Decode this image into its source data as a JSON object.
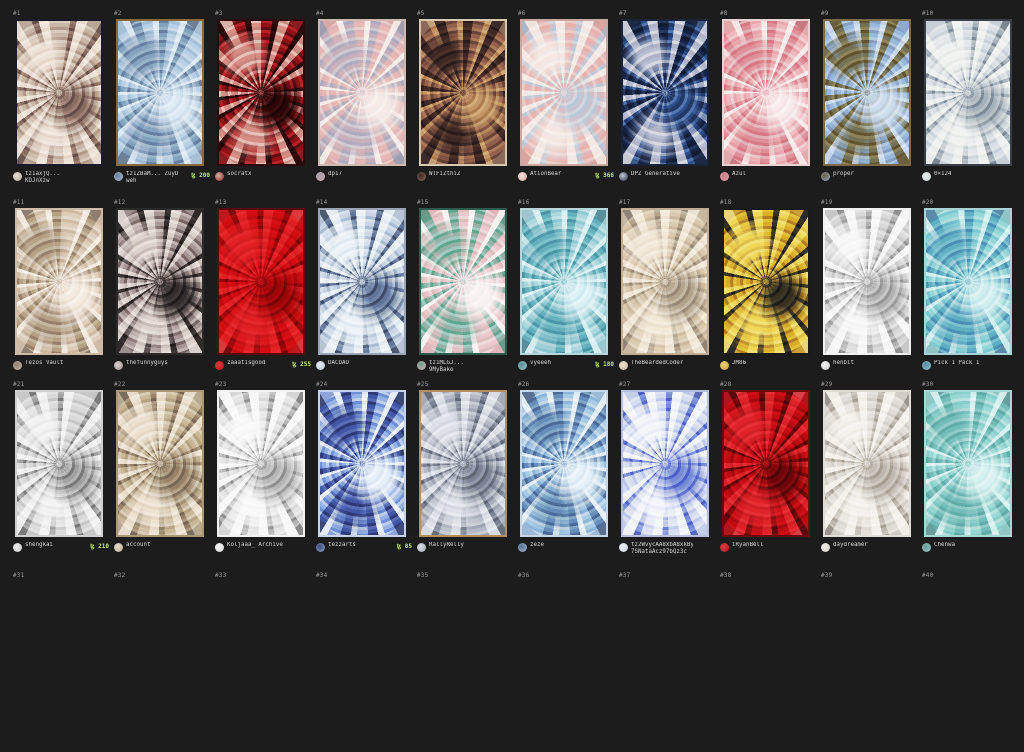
{
  "items": [
    {
      "num": "#1",
      "owner": "tz1axjQ... KDJnXzw",
      "price": "",
      "colors": [
        "#b9a79a",
        "#6d5a55",
        "#e8ddd2"
      ],
      "frame": "#1a1a2a"
    },
    {
      "num": "#2",
      "owner": "tz1ZBaM... ZuyD\nweh",
      "price": "ꜩ 200",
      "colors": [
        "#a9bfd6",
        "#d6e2ee",
        "#6e7f96"
      ],
      "frame": "#8a6a3a"
    },
    {
      "num": "#3",
      "owner": "socratx",
      "price": "",
      "colors": [
        "#8a1c22",
        "#2a0a0c",
        "#d8b0a8"
      ],
      "frame": "#2a0c0e"
    },
    {
      "num": "#4",
      "owner": "dp17",
      "price": "",
      "colors": [
        "#d9a9a6",
        "#f1e6e2",
        "#9f9eae"
      ],
      "frame": "#cdb9b2"
    },
    {
      "num": "#5",
      "owner": "WTFiZthiZ",
      "price": "",
      "colors": [
        "#8c6a5a",
        "#c2a07a",
        "#3a2a2a"
      ],
      "frame": "#d8c8b0"
    },
    {
      "num": "#6",
      "owner": "AtionBear",
      "price": "ꜩ 366",
      "colors": [
        "#d9a3a0",
        "#a8b8c8",
        "#efe2dc"
      ],
      "frame": "#c8a8a0"
    },
    {
      "num": "#7",
      "owner": "DPZ Generative",
      "price": "",
      "colors": [
        "#1c2a44",
        "#3e5a86",
        "#c8c8d4"
      ],
      "frame": "#1a2238"
    },
    {
      "num": "#8",
      "owner": "Azul",
      "price": "",
      "colors": [
        "#e2a9ad",
        "#f3e6e6",
        "#c77a82"
      ],
      "frame": "#e9d2d4"
    },
    {
      "num": "#9",
      "owner": "proper",
      "price": "",
      "colors": [
        "#90aacd",
        "#c8d6e6",
        "#6b6040"
      ],
      "frame": "#7b6a44"
    },
    {
      "num": "#10",
      "owner": "0×124",
      "price": "",
      "colors": [
        "#c9cfd6",
        "#7d8690",
        "#e9ece8"
      ],
      "frame": "#3a3e46"
    },
    {
      "num": "#11",
      "owner": "Tezos Vault",
      "price": "",
      "colors": [
        "#cdbba8",
        "#efe6dc",
        "#8f7f70"
      ],
      "frame": "#cdbba8"
    },
    {
      "num": "#12",
      "owner": "thefunnyguys",
      "price": "",
      "colors": [
        "#9a8e8e",
        "#2e2a2a",
        "#d8d0cc"
      ],
      "frame": "#2a2a2a"
    },
    {
      "num": "#13",
      "owner": "zaaatisgood",
      "price": "ꜩ 255",
      "colors": [
        "#c0161c",
        "#7a0a0e",
        "#d83a3e"
      ],
      "frame": "#5a0a0c"
    },
    {
      "num": "#14",
      "owner": "DACDAO",
      "price": "",
      "colors": [
        "#b8c4d6",
        "#4e5a70",
        "#e6ecf2"
      ],
      "frame": "#9aa6b8"
    },
    {
      "num": "#15",
      "owner": "tz1MLGJ... 9MyBako",
      "price": "",
      "colors": [
        "#e0b6bc",
        "#f6eeee",
        "#6a9a8a"
      ],
      "frame": "#2e5a4e"
    },
    {
      "num": "#16",
      "owner": "vyeeeh",
      "price": "ꜩ 180",
      "colors": [
        "#9fc6cf",
        "#d6ecef",
        "#5a8e9a"
      ],
      "frame": "#b6d6dc"
    },
    {
      "num": "#17",
      "owner": "TheBeardedCoder",
      "price": "",
      "colors": [
        "#c9b8a0",
        "#8e8478",
        "#ece2d2"
      ],
      "frame": "#c0ac94"
    },
    {
      "num": "#18",
      "owner": "JM86",
      "price": "",
      "colors": [
        "#c9a03a",
        "#2a2a2a",
        "#e8d27a"
      ],
      "frame": "#1a1a1a"
    },
    {
      "num": "#19",
      "owner": "henbit",
      "price": "",
      "colors": [
        "#c8c8c8",
        "#8e8e8e",
        "#f4f4f4"
      ],
      "frame": "#f0f0f0"
    },
    {
      "num": "#20",
      "owner": "Pick 1 Pack 1",
      "price": "",
      "colors": [
        "#8ec6c8",
        "#cfe9ea",
        "#5a8aa6"
      ],
      "frame": "#a6d4d6"
    },
    {
      "num": "#21",
      "owner": "shengkai",
      "price": "ꜩ 210",
      "colors": [
        "#c8c8c8",
        "#7a7a7a",
        "#ececec"
      ],
      "frame": "#d0d0d0"
    },
    {
      "num": "#22",
      "owner": "account",
      "price": "",
      "colors": [
        "#b8a890",
        "#7a6e60",
        "#e6dccc"
      ],
      "frame": "#a89878"
    },
    {
      "num": "#23",
      "owner": "Koljaaa_ Archive",
      "price": "",
      "colors": [
        "#d6d6d6",
        "#8a8a8a",
        "#f6f6f6"
      ],
      "frame": "#f2f2f2"
    },
    {
      "num": "#24",
      "owner": "tezzarts",
      "price": "ꜩ 85",
      "colors": [
        "#8ea4d8",
        "#e6ecf6",
        "#3e4a78"
      ],
      "frame": "#c8d2ea"
    },
    {
      "num": "#25",
      "owner": "RallyRelly",
      "price": "",
      "colors": [
        "#a6aab4",
        "#6a6e78",
        "#d8dce2"
      ],
      "frame": "#b09060"
    },
    {
      "num": "#26",
      "owner": "zeze",
      "price": "",
      "colors": [
        "#9cbad6",
        "#e2ecf4",
        "#5a7090"
      ],
      "frame": "#c6d8e8"
    },
    {
      "num": "#27",
      "owner": "tz2WvycAA8xbA8xkBy7i\n7SNataAcz97bQz3c",
      "price": "",
      "colors": [
        "#c6cde6",
        "#5a68b8",
        "#eef0f6"
      ],
      "frame": "#b6bedc"
    },
    {
      "num": "#28",
      "owner": "iRyanBell",
      "price": "",
      "colors": [
        "#b0141c",
        "#5a0a0e",
        "#d84046"
      ],
      "frame": "#6a0a0e"
    },
    {
      "num": "#29",
      "owner": "daydreamer",
      "price": "",
      "colors": [
        "#d0ccc6",
        "#9a948c",
        "#f0ece6"
      ],
      "frame": "#e0dcd6"
    },
    {
      "num": "#30",
      "owner": "Chenwa",
      "price": "",
      "colors": [
        "#92c8c4",
        "#d4ecea",
        "#6a9e9c"
      ],
      "frame": "#a8d8d4"
    },
    {
      "num": "#31",
      "owner": "",
      "price": "",
      "colors": [
        "#333",
        "#333",
        "#333"
      ],
      "frame": "#1c1c1c"
    },
    {
      "num": "#32",
      "owner": "",
      "price": "",
      "colors": [
        "#333",
        "#333",
        "#333"
      ],
      "frame": "#1c1c1c"
    },
    {
      "num": "#33",
      "owner": "",
      "price": "",
      "colors": [
        "#333",
        "#333",
        "#333"
      ],
      "frame": "#1c1c1c"
    },
    {
      "num": "#34",
      "owner": "",
      "price": "",
      "colors": [
        "#333",
        "#333",
        "#333"
      ],
      "frame": "#1c1c1c"
    },
    {
      "num": "#35",
      "owner": "",
      "price": "",
      "colors": [
        "#333",
        "#333",
        "#333"
      ],
      "frame": "#1c1c1c"
    },
    {
      "num": "#36",
      "owner": "",
      "price": "",
      "colors": [
        "#333",
        "#333",
        "#333"
      ],
      "frame": "#1c1c1c"
    },
    {
      "num": "#37",
      "owner": "",
      "price": "",
      "colors": [
        "#333",
        "#333",
        "#333"
      ],
      "frame": "#1c1c1c"
    },
    {
      "num": "#38",
      "owner": "",
      "price": "",
      "colors": [
        "#333",
        "#333",
        "#333"
      ],
      "frame": "#1c1c1c"
    },
    {
      "num": "#39",
      "owner": "",
      "price": "",
      "colors": [
        "#333",
        "#333",
        "#333"
      ],
      "frame": "#1c1c1c"
    },
    {
      "num": "#40",
      "owner": "",
      "price": "",
      "colors": [
        "#333",
        "#333",
        "#333"
      ],
      "frame": "#1c1c1c"
    }
  ]
}
